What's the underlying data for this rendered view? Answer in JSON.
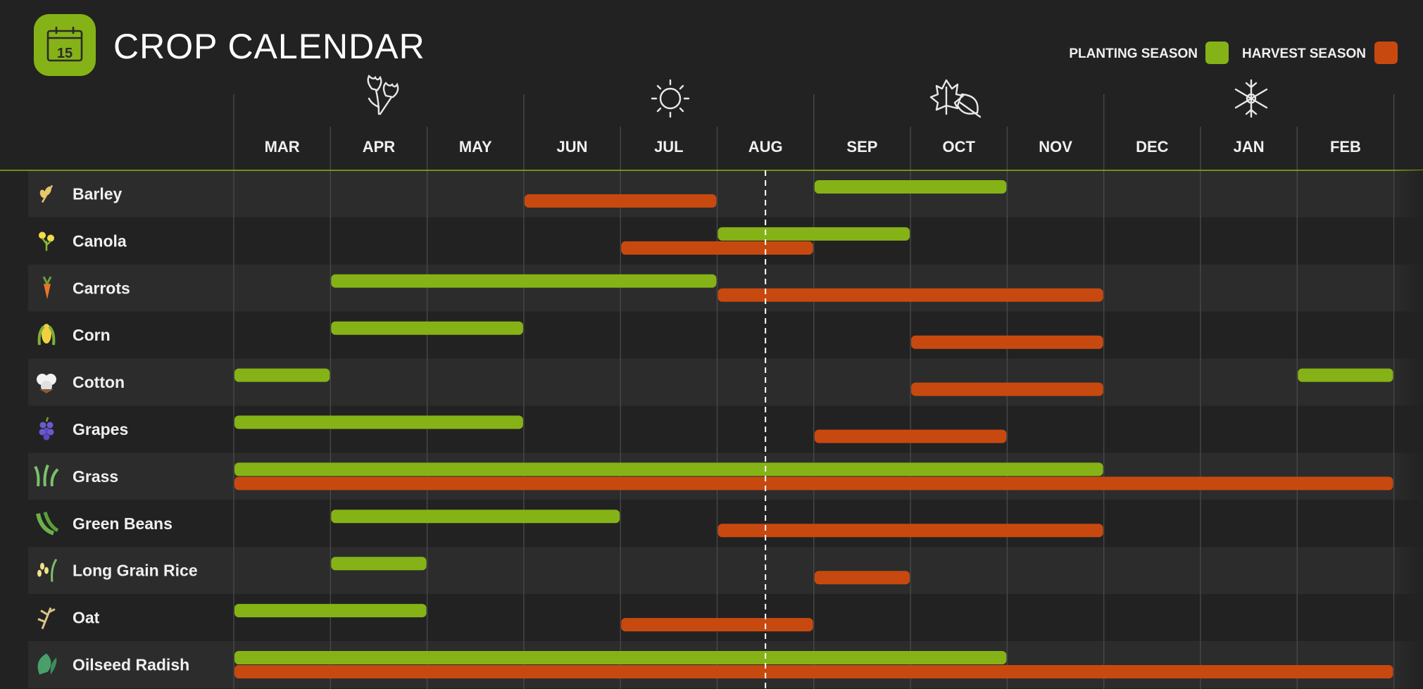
{
  "title": "CROP CALENDAR",
  "calendar_day": "15",
  "colors": {
    "background": "#222222",
    "planting": "#85b317",
    "harvest": "#c8490f",
    "header_line": "#85b317",
    "current_marker": "#ffffff"
  },
  "legend": {
    "position": "top-right",
    "items": [
      {
        "label": "PLANTING SEASON",
        "type": "planting"
      },
      {
        "label": "HARVEST SEASON",
        "type": "harvest"
      }
    ]
  },
  "season_icons": [
    "flowers-icon",
    "sun-icon",
    "autumn-leaves-icon",
    "snowflake-icon"
  ],
  "chart_data": {
    "type": "gantt",
    "title": "CROP CALENDAR",
    "months": [
      "MAR",
      "APR",
      "MAY",
      "JUN",
      "JUL",
      "AUG",
      "SEP",
      "OCT",
      "NOV",
      "DEC",
      "JAN",
      "FEB"
    ],
    "current_marker_month": "AUG",
    "current_marker_position": 5.5,
    "series": [
      {
        "name": "PLANTING SEASON"
      },
      {
        "name": "HARVEST SEASON"
      }
    ],
    "crops": [
      {
        "name": "Barley",
        "icon": "wheat-icon",
        "planting": [
          "SEP",
          "OCT"
        ],
        "harvest": [
          "JUN",
          "JUL"
        ]
      },
      {
        "name": "Canola",
        "icon": "canola-flower-icon",
        "planting": [
          "AUG",
          "SEP"
        ],
        "harvest": [
          "JUL",
          "AUG"
        ]
      },
      {
        "name": "Carrots",
        "icon": "carrot-icon",
        "planting": [
          "APR",
          "JUL"
        ],
        "harvest": [
          "AUG",
          "NOV"
        ]
      },
      {
        "name": "Corn",
        "icon": "corn-icon",
        "planting": [
          "APR",
          "MAY"
        ],
        "harvest": [
          "OCT",
          "NOV"
        ]
      },
      {
        "name": "Cotton",
        "icon": "cotton-icon",
        "planting": [
          "MAR",
          "MAR",
          "FEB",
          "FEB"
        ],
        "harvest": [
          "OCT",
          "NOV"
        ]
      },
      {
        "name": "Grapes",
        "icon": "grapes-icon",
        "planting": [
          "MAR",
          "MAY"
        ],
        "harvest": [
          "SEP",
          "OCT"
        ]
      },
      {
        "name": "Grass",
        "icon": "grass-icon",
        "planting": [
          "MAR",
          "NOV"
        ],
        "harvest": [
          "MAR",
          "FEB"
        ]
      },
      {
        "name": "Green Beans",
        "icon": "green-beans-icon",
        "planting": [
          "APR",
          "JUN"
        ],
        "harvest": [
          "AUG",
          "NOV"
        ]
      },
      {
        "name": "Long Grain Rice",
        "icon": "rice-icon",
        "planting": [
          "APR",
          "APR"
        ],
        "harvest": [
          "SEP",
          "SEP"
        ]
      },
      {
        "name": "Oat",
        "icon": "oat-icon",
        "planting": [
          "MAR",
          "APR"
        ],
        "harvest": [
          "JUL",
          "AUG"
        ]
      },
      {
        "name": "Oilseed Radish",
        "icon": "radish-leaf-icon",
        "planting": [
          "MAR",
          "OCT"
        ],
        "harvest": [
          "MAR",
          "FEB"
        ]
      }
    ]
  }
}
